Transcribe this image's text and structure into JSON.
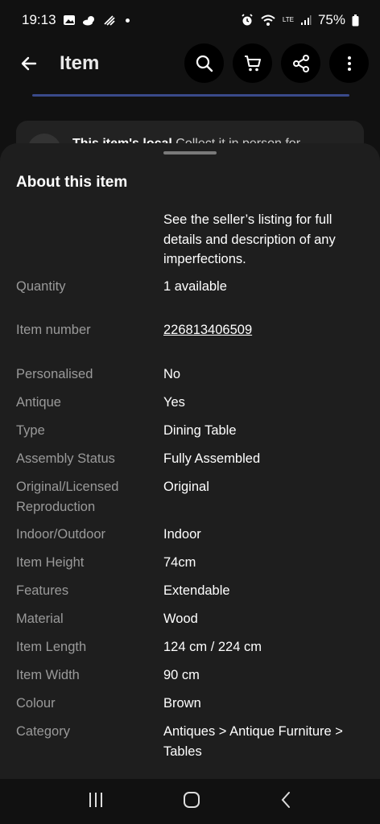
{
  "status": {
    "time": "19:13",
    "battery": "75%",
    "lte_label": "LTE"
  },
  "app_bar": {
    "title": "Item"
  },
  "background": {
    "banner_bold": "This item's local",
    "banner_text": "Collect it in person for"
  },
  "sheet": {
    "title": "About this item",
    "intro": "See the seller’s listing for full details and description of any imperfections.",
    "specs": [
      {
        "label": "Quantity",
        "value": "1 available"
      },
      {
        "label": "Item number",
        "value": "226813406509"
      },
      {
        "label": "Personalised",
        "value": "No"
      },
      {
        "label": "Antique",
        "value": "Yes"
      },
      {
        "label": "Type",
        "value": "Dining Table"
      },
      {
        "label": "Assembly Status",
        "value": "Fully Assembled"
      },
      {
        "label": "Original/Licensed Reproduction",
        "value": "Original"
      },
      {
        "label": "Indoor/Outdoor",
        "value": "Indoor"
      },
      {
        "label": "Item Height",
        "value": "74cm"
      },
      {
        "label": "Features",
        "value": "Extendable"
      },
      {
        "label": "Material",
        "value": "Wood"
      },
      {
        "label": "Item Length",
        "value": "124 cm / 224 cm"
      },
      {
        "label": "Item Width",
        "value": "90 cm"
      },
      {
        "label": "Colour",
        "value": "Brown"
      },
      {
        "label": "Category",
        "value": "Antiques > Antique Furniture > Tables"
      }
    ]
  },
  "icons": {
    "back": "arrow-left-icon",
    "search": "search-icon",
    "cart": "cart-icon",
    "share": "share-icon",
    "more": "more-vert-icon"
  },
  "colors": {
    "background": "#111111",
    "sheet": "#1e1e1e",
    "label": "#9a9a9a",
    "value": "#ffffff"
  }
}
